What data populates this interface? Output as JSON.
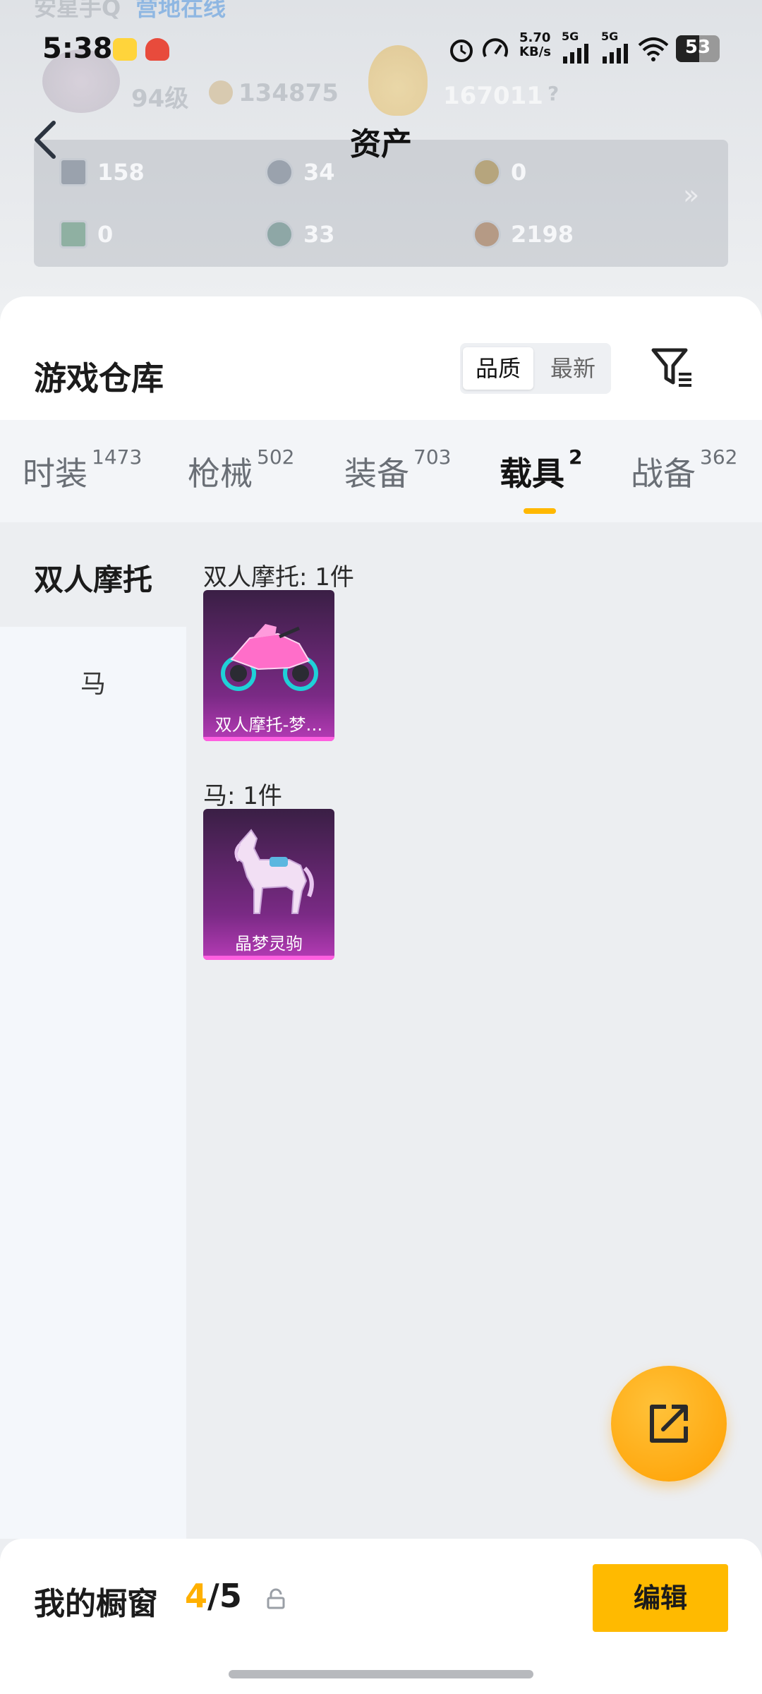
{
  "hero": {
    "top_text_left": "安星手Q",
    "top_text_right": "营地在线",
    "level": "94级",
    "coins": "134875",
    "score": "167011",
    "question": "?"
  },
  "status_bar": {
    "time": "5:38",
    "speed": "5.70\nKB/s",
    "net1": "5G",
    "net2": "5G",
    "battery": "53"
  },
  "header": {
    "title": "资产"
  },
  "assets": [
    {
      "value": "158"
    },
    {
      "value": "34"
    },
    {
      "value": "0"
    },
    {
      "value": "0"
    },
    {
      "value": "33"
    },
    {
      "value": "2198"
    }
  ],
  "assets_more": "»",
  "warehouse": {
    "title": "游戏仓库",
    "sort": [
      "品质",
      "最新"
    ]
  },
  "tabs": [
    {
      "label": "时装",
      "count": "1473"
    },
    {
      "label": "枪械",
      "count": "502"
    },
    {
      "label": "装备",
      "count": "703"
    },
    {
      "label": "载具",
      "count": "2"
    },
    {
      "label": "战备",
      "count": "362"
    }
  ],
  "side_nav": [
    {
      "label": "双人摩托"
    },
    {
      "label": "马"
    }
  ],
  "groups": [
    {
      "heading": "双人摩托: 1件",
      "item_name": "双人摩托-梦…"
    },
    {
      "heading": "马: 1件",
      "item_name": "晶梦灵驹"
    }
  ],
  "showcase": {
    "title": "我的橱窗",
    "current": "4",
    "total": "/5",
    "edit_label": "编辑"
  },
  "colors": {
    "accent": "#ffb800",
    "card_bg": "#7a2a85",
    "card_bar": "#ff5fe0"
  }
}
